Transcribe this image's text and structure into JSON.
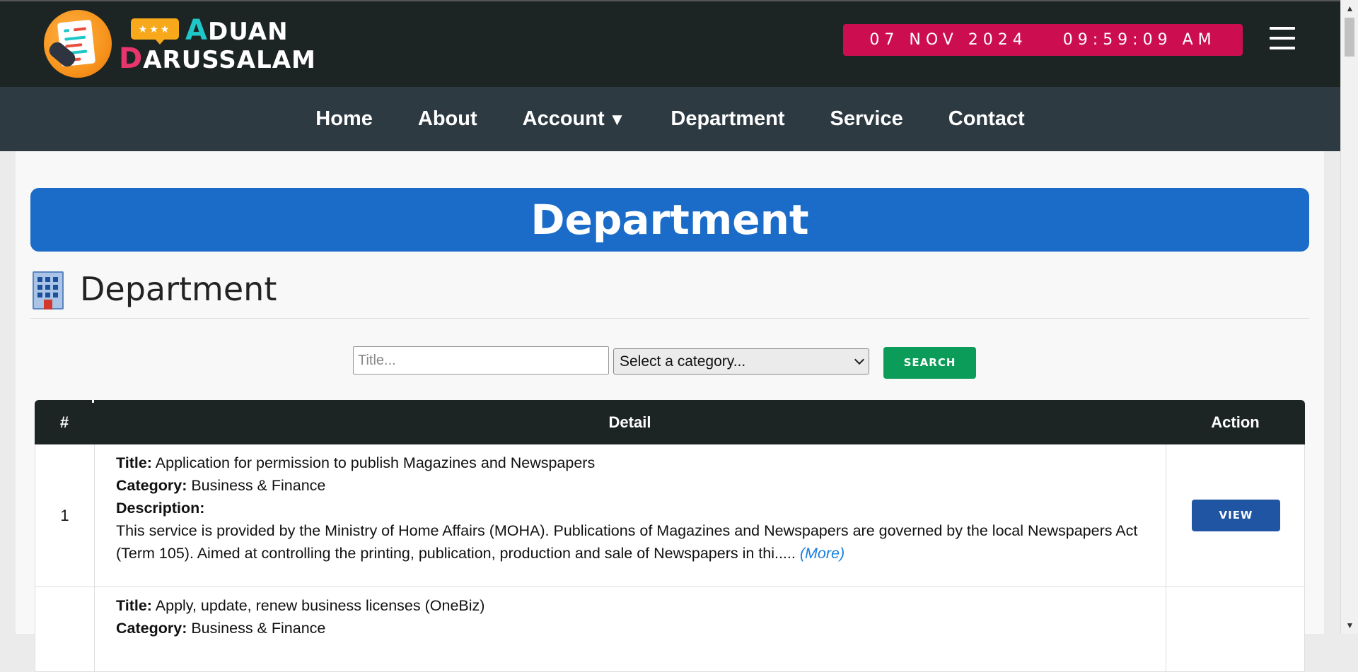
{
  "header": {
    "brand_line1_initial": "A",
    "brand_line1_rest": "DUAN",
    "brand_line2_initial": "D",
    "brand_line2_rest": "ARUSSALAM",
    "logo_bubble_text": "★★★",
    "date": "07 NOV 2024",
    "time": "09:59:09 AM",
    "menu_icon": "hamburger-icon",
    "colors": {
      "topbar_bg": "#1d2524",
      "clock_bg": "#cc0e50",
      "accent_teal": "#1ec8c8",
      "accent_pink": "#e8356d"
    }
  },
  "nav": {
    "items": [
      {
        "label": "Home"
      },
      {
        "label": "About"
      },
      {
        "label": "Account",
        "caret": "▼"
      },
      {
        "label": "Department"
      },
      {
        "label": "Service"
      },
      {
        "label": "Contact"
      }
    ],
    "bg": "#2d3a42"
  },
  "page": {
    "banner_title": "Department",
    "banner_color": "#1b6cc8",
    "section_title": "Department",
    "section_icon": "building-icon"
  },
  "search": {
    "title_placeholder": "Title...",
    "title_value": "",
    "category_selected": "Select a category...",
    "button_label": "SEARCH",
    "button_color": "#0a9c58"
  },
  "table": {
    "headers": {
      "num": "#",
      "detail": "Detail",
      "action": "Action"
    },
    "label_title": "Title:",
    "label_category": "Category:",
    "label_description": "Description:",
    "more_label": "(More)",
    "view_label": "VIEW",
    "rows": [
      {
        "num": "1",
        "title": "Application for permission to publish Magazines and Newspapers",
        "category": "Business & Finance",
        "description": "This service is provided by the Ministry of Home Affairs (MOHA). Publications of Magazines and Newspapers are governed by the local Newspapers Act (Term 105). Aimed at controlling the printing, publication, production and sale of Newspapers in thi....."
      },
      {
        "num": "",
        "title": "Apply, update, renew business licenses (OneBiz)",
        "category": "Business & Finance"
      }
    ]
  }
}
